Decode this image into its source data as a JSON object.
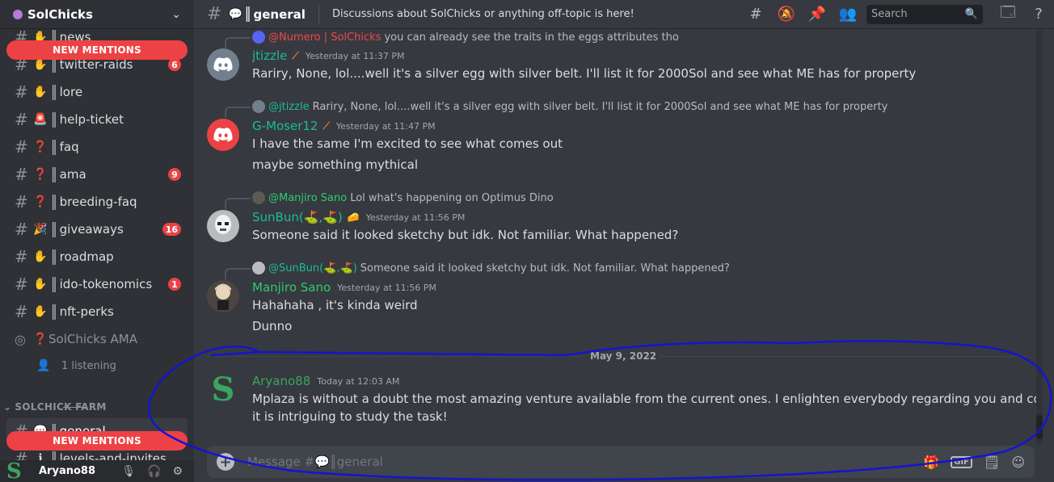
{
  "server": {
    "name": "SolChicks"
  },
  "sidebar": {
    "channels": [
      {
        "emoji": "✋",
        "name": "news",
        "badge": ""
      },
      {
        "emoji": "✋",
        "name": "twitter-raids",
        "badge": "6"
      },
      {
        "emoji": "✋",
        "name": "lore",
        "badge": ""
      },
      {
        "emoji": "🚨",
        "name": "help-ticket",
        "badge": ""
      },
      {
        "emoji": "❓",
        "name": "faq",
        "badge": ""
      },
      {
        "emoji": "❓",
        "name": "ama",
        "badge": "9"
      },
      {
        "emoji": "❓",
        "name": "breeding-faq",
        "badge": ""
      },
      {
        "emoji": "🎉",
        "name": "giveaways",
        "badge": "16"
      },
      {
        "emoji": "✋",
        "name": "roadmap",
        "badge": ""
      },
      {
        "emoji": "✋",
        "name": "ido-tokenomics",
        "badge": "1"
      },
      {
        "emoji": "✋",
        "name": "nft-perks",
        "badge": ""
      }
    ],
    "voice": {
      "emoji": "❓",
      "name": "SolChicks AMA",
      "listening": "1 listening"
    },
    "category": "SOLCHICK FARM",
    "selected": {
      "emoji": "💬",
      "name": "general"
    },
    "next": {
      "emoji": "ℹ",
      "name": "levels-and-invites",
      "badge": ""
    },
    "new_mentions_label": "NEW MENTIONS"
  },
  "user": {
    "avatar_letter": "S",
    "name": "Aryano88"
  },
  "header": {
    "channel_icon": "💬",
    "channel_name": "general",
    "topic": "Discussions about SolChicks or anything off-topic is here!",
    "search_placeholder": "Search"
  },
  "messages": [
    {
      "reply": {
        "author": "@Numero | SolChicks",
        "text": "you can already see the traits in the eggs attributes tho"
      },
      "author": "jtizzle",
      "author_color": "#1abc9c",
      "time": "Yesterday at 11:37 PM",
      "lines": [
        "Rariry, None, lol....well it's a silver egg with silver belt.  I'll list it for 2000Sol and see what ME has for property"
      ]
    },
    {
      "reply": {
        "author": "@jtizzle",
        "text": "Rariry, None, lol....well it's a silver egg with silver belt.  I'll list it for 2000Sol and see what ME has for property"
      },
      "author": "G-Moser12",
      "author_color": "#1abc9c",
      "time": "Yesterday at 11:47 PM",
      "lines": [
        "I have the same I'm excited to see what comes out",
        "maybe something mythical"
      ]
    },
    {
      "reply": {
        "author": "@Manjiro Sano",
        "text": "Lol what's happening on Optimus Dino"
      },
      "author": "SunBun(⛳,⛳)",
      "author_color": "#1abc9c",
      "time": "Yesterday at 11:56 PM",
      "lines": [
        "Someone said it looked sketchy but idk. Not familiar. What happened?"
      ]
    },
    {
      "reply": {
        "author": "@SunBun(⛳,⛳)",
        "text": "Someone said it looked sketchy but idk. Not familiar. What happened?"
      },
      "author": "Manjiro Sano",
      "author_color": "#2ecc71",
      "time": "Yesterday at 11:56 PM",
      "lines": [
        "Hahahaha , it's kinda weird",
        "Dunno"
      ]
    },
    {
      "author": "Aryano88",
      "author_color": "#3ba55c",
      "time": "Today at 12:03 AM",
      "lines": [
        "Mplaza is without a doubt the most amazing venture available from the current ones. I enlighten everybody regarding you and companions",
        "it is intriguing to study the task!"
      ]
    }
  ],
  "date_divider": "May 9, 2022",
  "composer": {
    "placeholder": "Message #💬║general",
    "gif": "GIF"
  },
  "colors": {
    "accent_blue": "#5865f2",
    "danger": "#ed4245",
    "annotation": "#1414d0"
  }
}
